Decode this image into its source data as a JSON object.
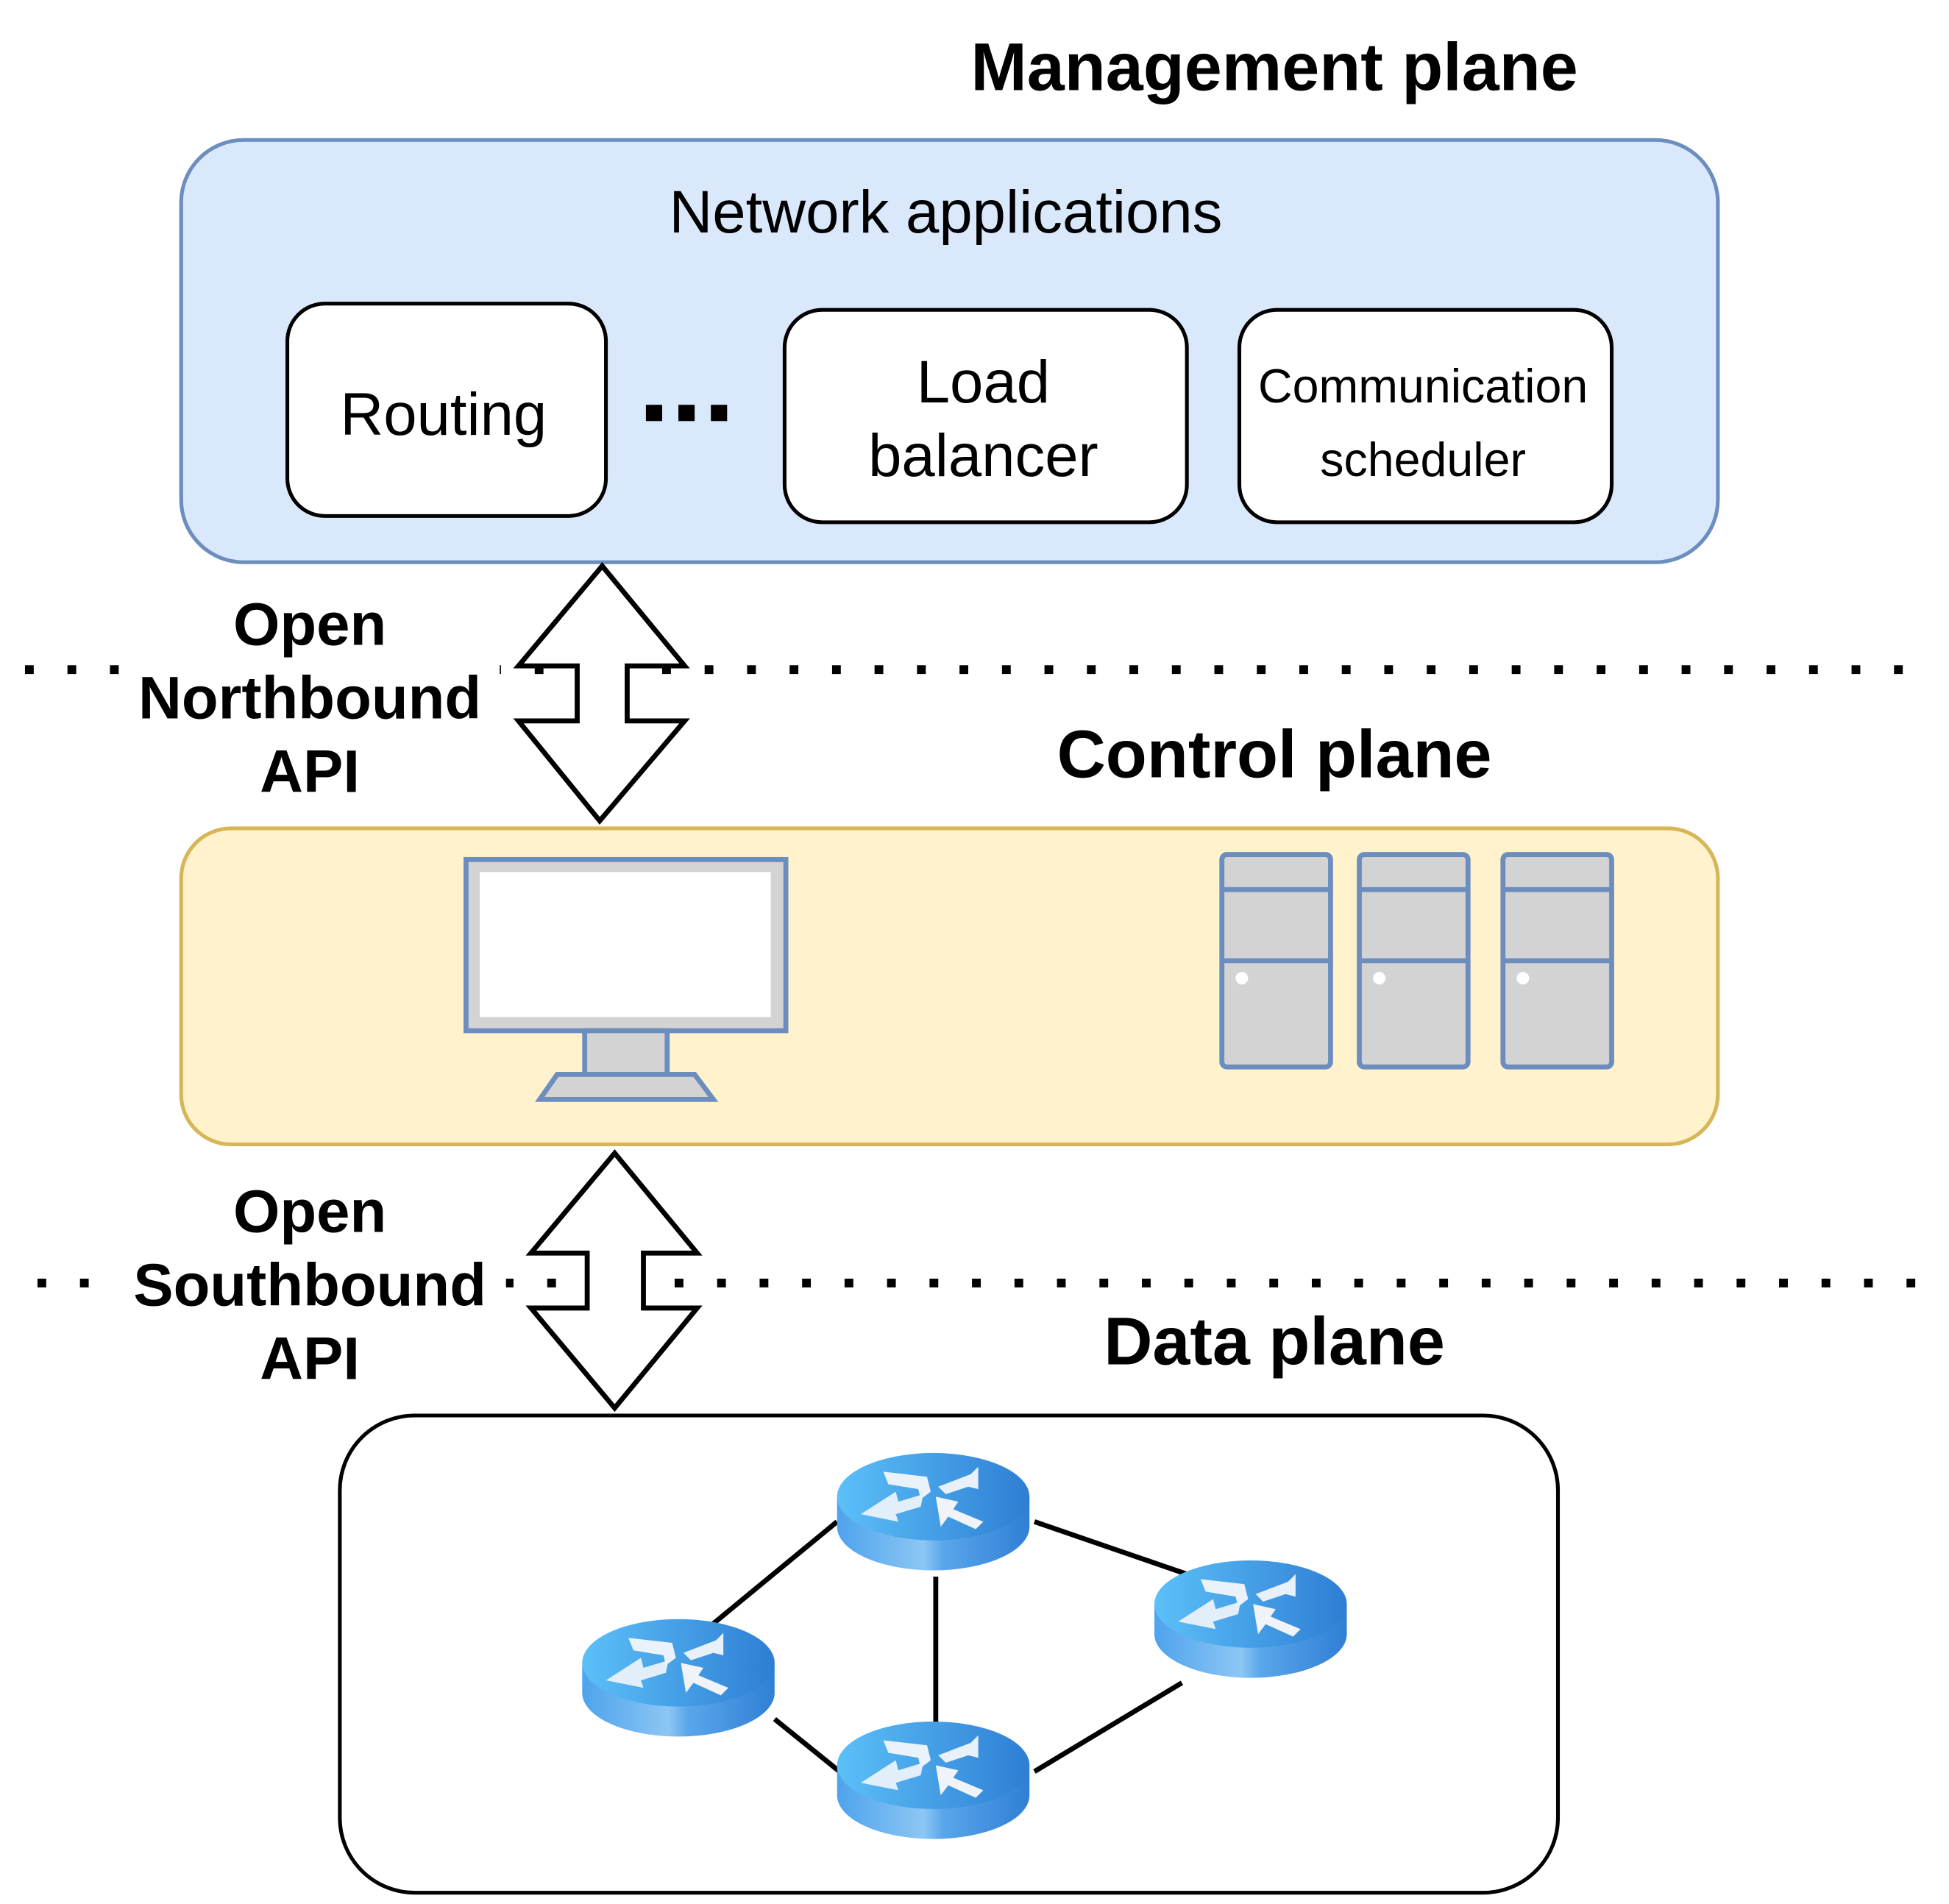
{
  "management_plane": {
    "title": "Management plane",
    "container_label": "Network applications",
    "apps": [
      {
        "lines": [
          "Routing"
        ]
      },
      {
        "lines": [
          "Load",
          "balancer"
        ]
      },
      {
        "lines": [
          "Communication",
          "scheduler"
        ]
      }
    ],
    "ellipsis": "..."
  },
  "northbound": {
    "lines": [
      "Open",
      "Northbound",
      "API"
    ]
  },
  "control_plane": {
    "title": "Control plane",
    "icons": [
      "monitor-icon",
      "server-icon",
      "server-icon",
      "server-icon"
    ]
  },
  "southbound": {
    "lines": [
      "Open",
      "Southbound",
      "API"
    ]
  },
  "data_plane": {
    "title": "Data plane",
    "icons": [
      "router-icon",
      "router-icon",
      "router-icon",
      "router-icon"
    ]
  },
  "colors": {
    "management_fill": "#dae8fc",
    "management_stroke": "#6c8ebf",
    "control_fill": "#fff2cc",
    "control_stroke": "#d6b656",
    "router_blue": "#3f95e0"
  }
}
